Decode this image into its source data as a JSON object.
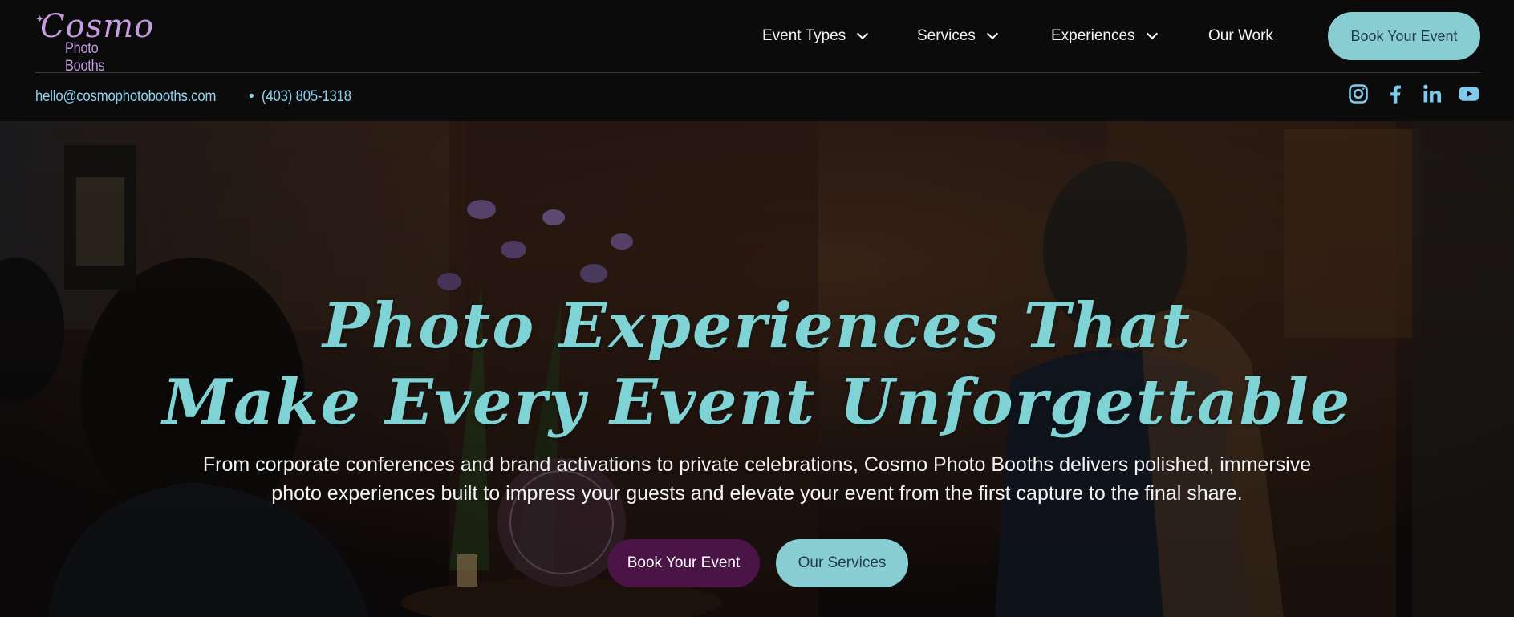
{
  "brand": {
    "logo_script": "Cosmo",
    "logo_sub": "Photo Booths",
    "accent_purple": "#c69be0",
    "accent_teal": "#88cdd2",
    "accent_plum": "#4a1446"
  },
  "nav": {
    "items": [
      {
        "label": "Event Types",
        "has_dropdown": true
      },
      {
        "label": "Services",
        "has_dropdown": true
      },
      {
        "label": "Experiences",
        "has_dropdown": true
      },
      {
        "label": "Our Work",
        "has_dropdown": false
      }
    ],
    "cta_label": "Book Your Event"
  },
  "contact": {
    "email": "hello@cosmophotobooths.com",
    "separator": "•",
    "phone": "(403) 805-1318"
  },
  "social": [
    {
      "icon": "instagram-icon"
    },
    {
      "icon": "facebook-icon"
    },
    {
      "icon": "linkedin-icon"
    },
    {
      "icon": "youtube-icon"
    }
  ],
  "hero": {
    "headline_line1": "Photo Experiences That",
    "headline_line2": "Make Every Event Unforgettable",
    "lead": "From corporate conferences and brand activations to private celebrations, Cosmo Photo Booths delivers polished, immersive photo experiences built to impress your guests and elevate your event from the first capture to the final share.",
    "primary_button": "Book Your Event",
    "secondary_button": "Our Services"
  }
}
